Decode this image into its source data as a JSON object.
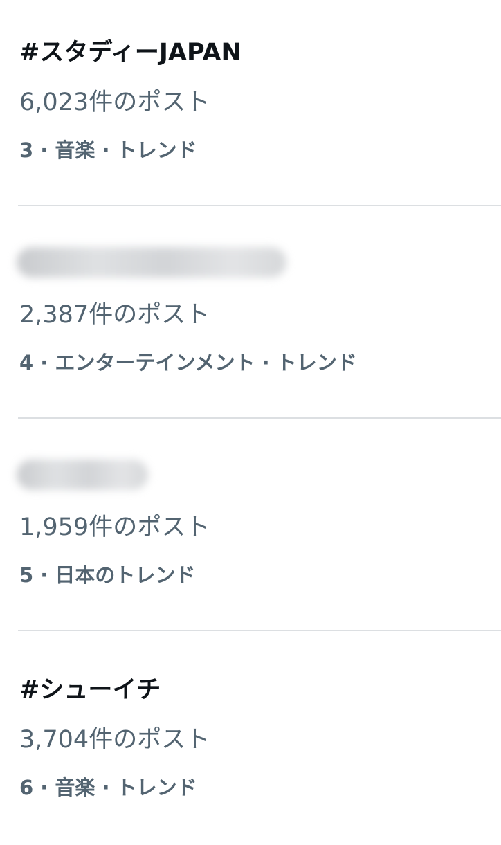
{
  "trends": [
    {
      "title": "#スタディーJAPAN",
      "count": "6,023件のポスト",
      "context": "3 · 音楽 · トレンド"
    },
    {
      "title": "",
      "count": "2,387件のポスト",
      "context": "4 · エンターテインメント · トレンド"
    },
    {
      "title": "",
      "count": "1,959件のポスト",
      "context": "5 · 日本のトレンド"
    },
    {
      "title": "#シューイチ",
      "count": "3,704件のポスト",
      "context": "6 · 音楽 · トレンド"
    }
  ]
}
